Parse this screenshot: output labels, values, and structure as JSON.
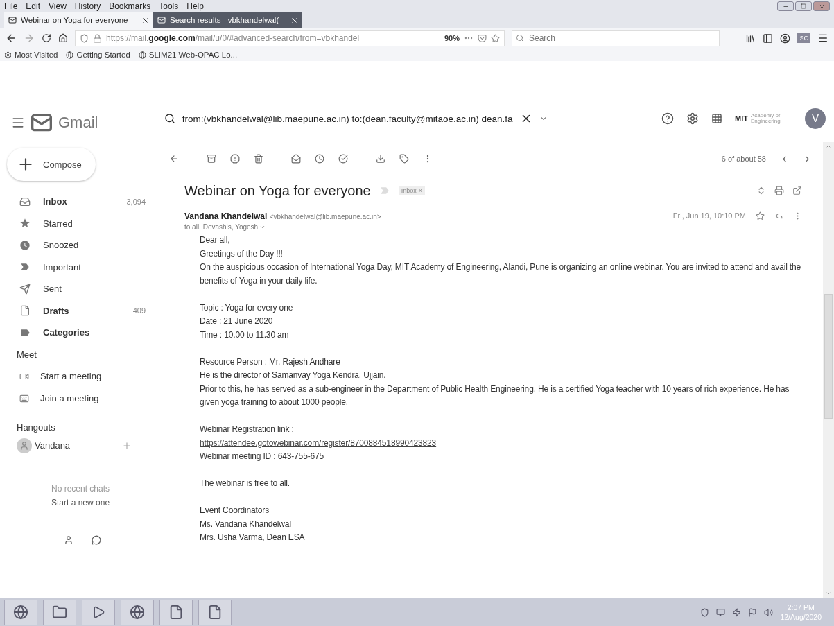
{
  "menu_bar": [
    "File",
    "Edit",
    "View",
    "History",
    "Bookmarks",
    "Tools",
    "Help"
  ],
  "browser_tabs": [
    {
      "label": "Webinar on Yoga for everyone",
      "selected": true
    },
    {
      "label": "Search results - vbkhandelwal(",
      "selected": false
    }
  ],
  "address_bar": {
    "url_plain": "https://mail.",
    "url_domain": "google.com",
    "url_path": "/mail/u/0/#advanced-search/from=vbkhandel",
    "zoom": "90%"
  },
  "browser_search": {
    "placeholder": "Search"
  },
  "profile_badge": "SC",
  "bookmarks": [
    "Most Visited",
    "Getting Started",
    "SLIM21 Web-OPAC Lo..."
  ],
  "gmail": {
    "logo_text": "Gmail",
    "search_query": "from:(vbkhandelwal@lib.maepune.ac.in) to:(dean.faculty@mitaoe.ac.in) dean.fa",
    "org_logo": "MIT",
    "org_subtitle": "Academy of Engineering",
    "avatar_letter": "V"
  },
  "compose": "Compose",
  "folders": [
    {
      "label": "Inbox",
      "count": "3,094",
      "unread": true
    },
    {
      "label": "Starred",
      "unread": false
    },
    {
      "label": "Snoozed",
      "unread": false
    },
    {
      "label": "Important",
      "unread": false
    },
    {
      "label": "Sent",
      "unread": false
    },
    {
      "label": "Drafts",
      "count": "409",
      "unread": true
    },
    {
      "label": "Categories",
      "unread": true
    }
  ],
  "meet": {
    "heading": "Meet",
    "items": [
      "Start a meeting",
      "Join a meeting"
    ]
  },
  "hangouts": {
    "heading": "Hangouts",
    "user": "Vandana",
    "empty_text": "No recent chats",
    "start_link": "Start a new one"
  },
  "pagination": "6 of about 58",
  "message": {
    "subject": "Webinar on Yoga for everyone",
    "label": "Inbox",
    "label_close": "×",
    "sender_name": "Vandana Khandelwal",
    "sender_email": "<vbkhandelwal@lib.maepune.ac.in>",
    "recipients": "to all, Devashis, Yogesh",
    "date": "Fri, Jun 19, 10:10 PM",
    "paragraphs": [
      [
        {
          "kind": "text",
          "text": "Dear all,"
        },
        {
          "kind": "text",
          "text": "Greetings of the Day !!!"
        },
        {
          "kind": "text",
          "text": "On the auspicious occasion of International Yoga Day, MIT Academy of Engineering, Alandi, Pune is organizing an online webinar. You are invited to attend and avail the benefits of Yoga in your daily life."
        }
      ],
      [
        {
          "kind": "text",
          "text": "Topic : Yoga for every one"
        },
        {
          "kind": "text",
          "text": "Date   :  21 June 2020"
        },
        {
          "kind": "text",
          "text": "Time  :  10.00 to 11.30 am"
        }
      ],
      [
        {
          "kind": "text",
          "text": "Resource Person : Mr. Rajesh Andhare"
        },
        {
          "kind": "text",
          "text": "He is the director of Samanvay Yoga Kendra, Ujjain."
        },
        {
          "kind": "text",
          "text": "Prior to this, he has served as a sub-engineer in the Department of Public Health Engineering. He is a certified Yoga teacher with 10 years of rich experience. He has given yoga training to about 1000 people."
        }
      ],
      [
        {
          "kind": "text",
          "text": "Webinar Registration link  :"
        },
        {
          "kind": "link",
          "text": "https://attendee.gotowebinar.com/register/8700884518990423823"
        },
        {
          "kind": "text",
          "text": "Webinar meeting ID  : 643-755-675"
        }
      ],
      [
        {
          "kind": "text",
          "text": "The webinar is free to all."
        }
      ],
      [
        {
          "kind": "text",
          "text": "Event Coordinators"
        },
        {
          "kind": "text",
          "text": "Ms. Vandana Khandelwal"
        },
        {
          "kind": "text",
          "text": "Mrs. Usha Varma, Dean ESA"
        }
      ]
    ]
  },
  "clock": {
    "time": "2:07 PM",
    "date": "12/Aug/2020"
  }
}
